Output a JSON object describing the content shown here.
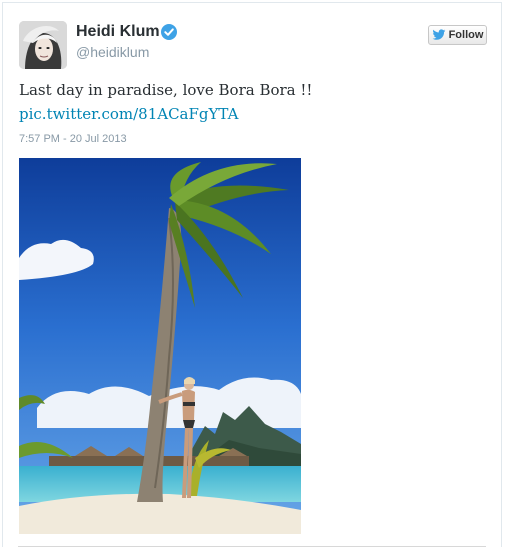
{
  "tweet": {
    "author_name": "Heidi Klum",
    "author_handle": "@heidiklum",
    "text": "Last day in paradise, love Bora Bora !!",
    "link_text": "pic.twitter.com/81ACaFgYTA",
    "timestamp": "7:57 PM - 20 Jul 2013",
    "verified": true
  },
  "follow_button": {
    "label": "Follow",
    "icon": "twitter-bird-icon"
  },
  "colors": {
    "link": "#0084b4",
    "verified_badge": "#3ea2e6",
    "name": "#292f33",
    "meta": "#8899a6"
  }
}
